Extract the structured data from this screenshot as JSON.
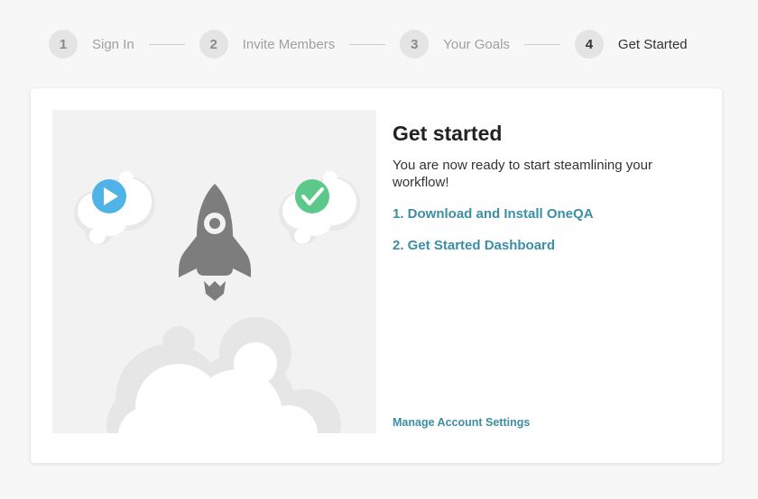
{
  "stepper": {
    "steps": [
      {
        "number": "1",
        "label": "Sign In"
      },
      {
        "number": "2",
        "label": "Invite Members"
      },
      {
        "number": "3",
        "label": "Your Goals"
      },
      {
        "number": "4",
        "label": "Get Started"
      }
    ],
    "active_step": "4"
  },
  "card": {
    "title": "Get started",
    "description": "You are now ready to start steamlining your workflow!",
    "links": [
      {
        "label": "1. Download and Install OneQA"
      },
      {
        "label": "2. Get Started Dashboard"
      }
    ],
    "manage_link": "Manage Account Settings"
  },
  "illustration": {
    "icons": [
      "play-icon",
      "rocket-icon",
      "check-icon",
      "cloud-icon"
    ]
  },
  "colors": {
    "link": "#3b8ea5",
    "play": "#4fb3e8",
    "check": "#5cc98b",
    "rocket": "#7d7d7d",
    "step_circle": "#e4e4e4"
  }
}
